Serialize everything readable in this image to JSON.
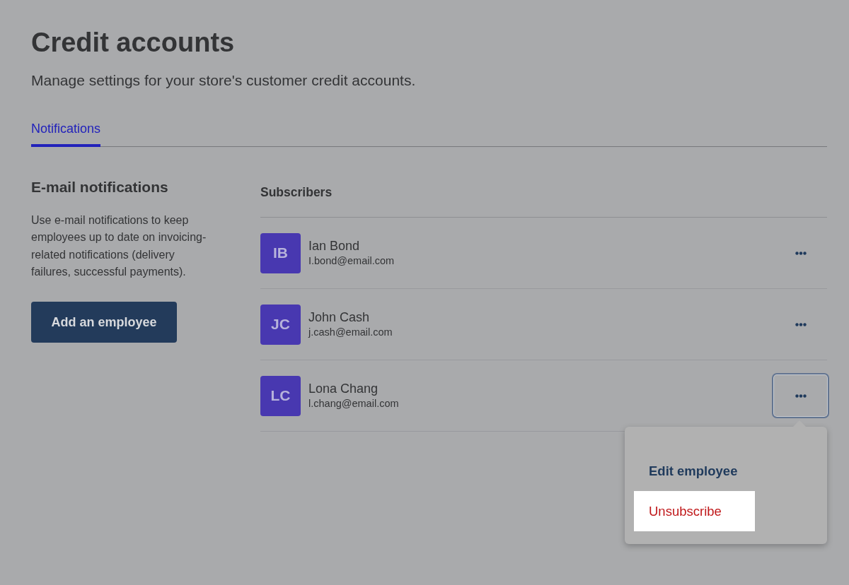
{
  "title": "Credit accounts",
  "subtitle": "Manage settings for your store's customer credit accounts.",
  "tabs": [
    {
      "label": "Notifications",
      "selected": true
    }
  ],
  "section": {
    "heading": "E-mail notifications",
    "description": "Use e-mail notifications to keep employees up to date on invoicing-related notifications (delivery failures, successful payments).",
    "button": "Add an employee"
  },
  "subscribers": {
    "heading": "Subscribers",
    "rows": [
      {
        "initials": "IB",
        "name": "Ian Bond",
        "email": "I.bond@email.com",
        "menu_open": false
      },
      {
        "initials": "JC",
        "name": "John Cash",
        "email": "j.cash@email.com",
        "menu_open": false
      },
      {
        "initials": "LC",
        "name": "Lona Chang",
        "email": "l.chang@email.com",
        "menu_open": true
      }
    ]
  },
  "menu": {
    "items": [
      {
        "label": "Edit employee",
        "kind": "default",
        "highlighted": false
      },
      {
        "label": "Unsubscribe",
        "kind": "danger",
        "highlighted": true
      }
    ]
  }
}
